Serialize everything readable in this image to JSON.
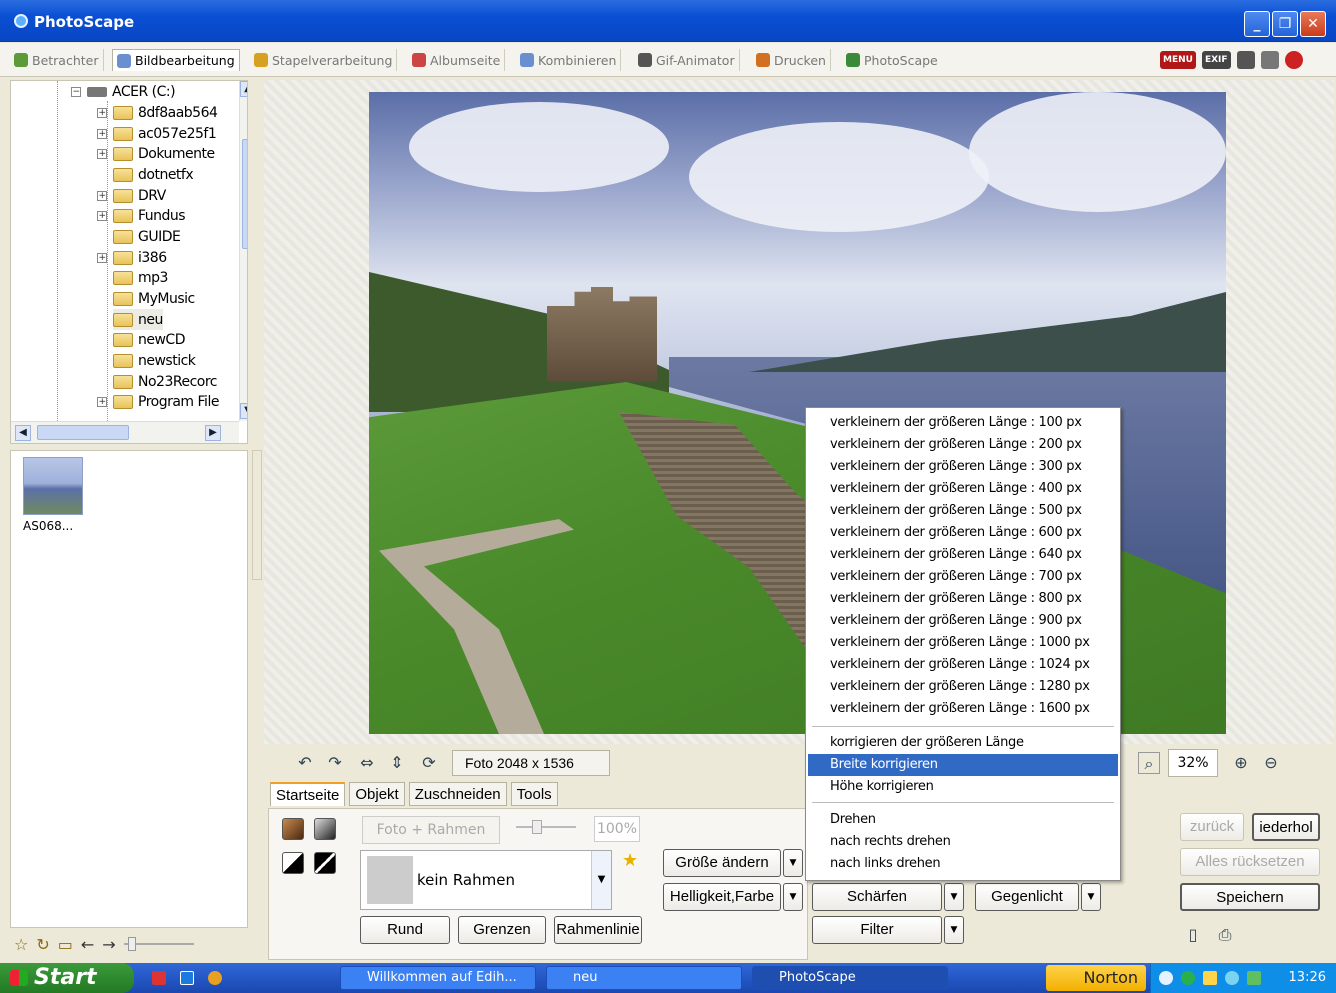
{
  "window": {
    "title": "PhotoScape"
  },
  "tabs": [
    {
      "label": "Betrachter"
    },
    {
      "label": "Bildbearbeitung"
    },
    {
      "label": "Stapelverarbeitung"
    },
    {
      "label": "Albumseite"
    },
    {
      "label": "Kombinieren"
    },
    {
      "label": "Gif-Animator"
    },
    {
      "label": "Drucken"
    },
    {
      "label": "PhotoScape"
    }
  ],
  "right_tools": {
    "menu": "MENU",
    "exif": "EXIF"
  },
  "tree": {
    "root": "ACER (C:)",
    "items": [
      {
        "label": "8df8aab564"
      },
      {
        "label": "ac057e25f1"
      },
      {
        "label": "Dokumente"
      },
      {
        "label": "dotnetfx"
      },
      {
        "label": "DRV"
      },
      {
        "label": "Fundus"
      },
      {
        "label": "GUIDE"
      },
      {
        "label": "i386"
      },
      {
        "label": "mp3"
      },
      {
        "label": "MyMusic"
      },
      {
        "label": "neu"
      },
      {
        "label": "newCD"
      },
      {
        "label": "newstick"
      },
      {
        "label": "No23Recorc"
      },
      {
        "label": "Program File"
      }
    ]
  },
  "thumbnail": {
    "caption": "AS068..."
  },
  "viewer": {
    "photo_info": "Foto 2048 x 1536",
    "zoom": "32%"
  },
  "subtabs": [
    {
      "label": "Startseite"
    },
    {
      "label": "Objekt"
    },
    {
      "label": "Zuschneiden"
    },
    {
      "label": "Tools"
    }
  ],
  "frame": {
    "foto_rahmen": "Foto + Rahmen",
    "percent": "100%",
    "selected": "kein Rahmen",
    "btn_rund": "Rund",
    "btn_grenzen": "Grenzen",
    "btn_rahmenlinie": "Rahmenlinie"
  },
  "actions": {
    "groesse": "Größe ändern",
    "helligkeit": "Helligkeit,Farbe",
    "schaerfen": "Schärfen",
    "gegenlicht": "Gegenlicht",
    "filter": "Filter",
    "zurueck": "zurück",
    "wiederholen": "iederhol",
    "alles_zuruecksetzen": "Alles rücksetzen",
    "speichern": "Speichern"
  },
  "context_menu": {
    "sizes": [
      "verkleinern der größeren Länge : 100 px",
      "verkleinern der größeren Länge : 200 px",
      "verkleinern der größeren Länge : 300 px",
      "verkleinern der größeren Länge : 400 px",
      "verkleinern der größeren Länge : 500 px",
      "verkleinern der größeren Länge : 600 px",
      "verkleinern der größeren Länge : 640 px",
      "verkleinern der größeren Länge : 700 px",
      "verkleinern der größeren Länge : 800 px",
      "verkleinern der größeren Länge : 900 px",
      "verkleinern der größeren Länge : 1000 px",
      "verkleinern der größeren Länge : 1024 px",
      "verkleinern der größeren Länge : 1280 px",
      "verkleinern der größeren Länge : 1600 px"
    ],
    "korrigieren": "korrigieren der größeren Länge",
    "breite": "Breite korrigieren",
    "hoehe": "Höhe korrigieren",
    "drehen": "Drehen",
    "rechts": "nach rechts drehen",
    "links": "nach links drehen"
  },
  "taskbar": {
    "start": "Start",
    "items": [
      {
        "label": "Willkommen auf Edih..."
      },
      {
        "label": "neu"
      },
      {
        "label": "PhotoScape"
      }
    ],
    "norton": "Norton",
    "clock": "13:26"
  }
}
